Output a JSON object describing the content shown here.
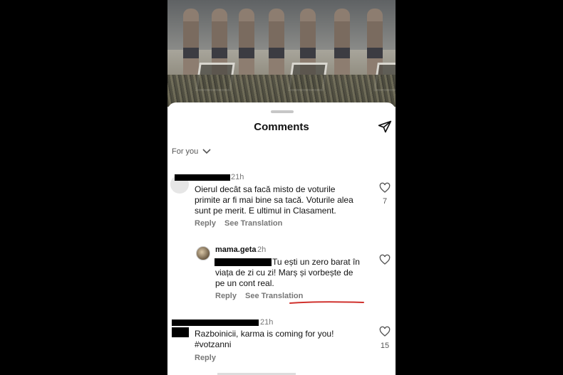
{
  "sheet": {
    "title": "Comments",
    "filter_label": "For you",
    "icons": {
      "share": "send-icon",
      "filter_chevron": "chevron-down-icon",
      "like": "heart-outline-icon"
    }
  },
  "comments": [
    {
      "username_redacted": true,
      "time": "21h",
      "text_lines": [
        "Oierul decât sa facă misto de voturile",
        "primite ar fi mai bine sa tacă. Voturile alea",
        "sunt pe merit. E ultimul in Clasament."
      ],
      "reply_label": "Reply",
      "translate_label": "See Translation",
      "likes": "7"
    },
    {
      "username": "mama.geta",
      "time": "2h",
      "mention_redacted": true,
      "text_lines": [
        "Tu ești un zero barat în",
        "viața de zi cu zi! Marș și vorbește de",
        "pe un cont real."
      ],
      "reply_label": "Reply",
      "translate_label": "See Translation"
    },
    {
      "username_redacted": true,
      "time": "21h",
      "text_lines": [
        "Razboinicii, karma is coming for you!",
        "#votzanni"
      ],
      "reply_label": "Reply",
      "likes": "15"
    }
  ],
  "colors": {
    "annotation_underline": "#d0312d",
    "text_primary": "#111111",
    "text_secondary": "#777777"
  }
}
